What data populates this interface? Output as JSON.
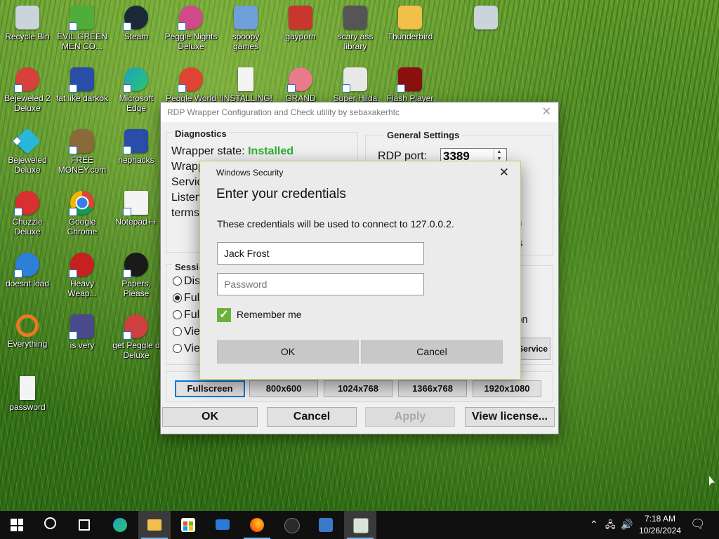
{
  "desktop_icons": [
    {
      "label": "Recycle Bin",
      "icon": "recycle-bin-icon",
      "color": "#c9d4dd"
    },
    {
      "label": "EVIL GREEN MEN CO...",
      "icon": "green-men-icon",
      "color": "#4fae3a"
    },
    {
      "label": "Steam",
      "icon": "steam-icon",
      "color": "#1b2838"
    },
    {
      "label": "Peggle Nights Deluxe",
      "icon": "peggle-nights-icon",
      "color": "#d04a8a"
    },
    {
      "label": "spoopy games",
      "icon": "folder-computers-icon",
      "color": "#6fa0d8"
    },
    {
      "label": "gayporn",
      "icon": "flash-folder-icon",
      "color": "#c8372d"
    },
    {
      "label": "scary ass library",
      "icon": "library-icon",
      "color": "#555555"
    },
    {
      "label": "Thunderbird",
      "icon": "folder-windows-icon",
      "color": "#f2c04a"
    },
    {
      "label": "",
      "icon": "recycle-bin-icon",
      "color": "#c9d4dd"
    },
    {
      "label": "Bejeweled 2 Deluxe",
      "icon": "bejeweled2-icon",
      "color": "#d8403c"
    },
    {
      "label": "fat like darkok",
      "icon": "mugen-icon",
      "color": "#2a4da8"
    },
    {
      "label": "Microsoft Edge",
      "icon": "edge-icon",
      "color": "#1aa3c8"
    },
    {
      "label": "Peggle World",
      "icon": "peggle-world-icon",
      "color": "#e04432"
    },
    {
      "label": "!INSTALLING!",
      "icon": "text-file-icon",
      "color": "#f4f4f4"
    },
    {
      "label": "GRAND",
      "icon": "anime-girl-icon",
      "color": "#e87a8a"
    },
    {
      "label": "Super Hilda",
      "icon": "hilda-icon",
      "color": "#e8e8e8"
    },
    {
      "label": "Flash Player",
      "icon": "flash-player-icon",
      "color": "#8a1010"
    },
    {
      "label": "Bejeweled Deluxe",
      "icon": "bejeweled-icon",
      "color": "#28b7d8"
    },
    {
      "label": "FREE MONEY.com",
      "icon": "money-bag-icon",
      "color": "#8a6a3a"
    },
    {
      "label": "nephacks",
      "icon": "mugen2-icon",
      "color": "#2a4da8"
    },
    {
      "label": "Chuzzle Deluxe",
      "icon": "chuzzle-icon",
      "color": "#d83030"
    },
    {
      "label": "Google Chrome",
      "icon": "chrome-icon",
      "color": "#e8c020"
    },
    {
      "label": "Notepad++",
      "icon": "notepadpp-icon",
      "color": "#f4f4f4"
    },
    {
      "label": "doesnt load",
      "icon": "globe-icon",
      "color": "#2e7fd8"
    },
    {
      "label": "Heavy Weap...",
      "icon": "heavy-weapon-icon",
      "color": "#c82020"
    },
    {
      "label": "Papers, Please",
      "icon": "papers-please-icon",
      "color": "#1a1a1a"
    },
    {
      "label": "Everything",
      "icon": "everything-icon",
      "color": "#e87a20"
    },
    {
      "label": "is very",
      "icon": "mugen3-icon",
      "color": "#4a4a8a"
    },
    {
      "label": "get Peggle d Deluxe",
      "icon": "peggle-deluxe-icon",
      "color": "#d04040"
    },
    {
      "label": "password",
      "icon": "text-file-icon",
      "color": "#f4f4f4"
    }
  ],
  "rdp_window": {
    "title": "RDP Wrapper Configuration and Check utility by sebaxakerhtc",
    "diagnostics_title": "Diagnostics",
    "wrapper_state_label": "Wrapper state:",
    "wrapper_state_value": "Installed",
    "partial_lines": [
      "Wrapp",
      "Servic",
      "Listen",
      "terms"
    ],
    "general_settings_title": "General Settings",
    "rdp_port_label": "RDP port:",
    "rdp_port_value": "3389",
    "right_partials": [
      "n",
      "s",
      "on"
    ],
    "service_btn_partial": "Service",
    "session_title_partial": "Sessio",
    "radio_options": [
      "Dis",
      "Full",
      "Ful",
      "Vie",
      "Vie"
    ],
    "resolutions": [
      "Fullscreen",
      "800x600",
      "1024x768",
      "1366x768",
      "1920x1080"
    ],
    "ok_label": "OK",
    "cancel_label": "Cancel",
    "apply_label": "Apply",
    "license_label": "View license..."
  },
  "credentials": {
    "window_title": "Windows Security",
    "heading": "Enter your credentials",
    "description": "These credentials will be used to connect to 127.0.0.2.",
    "username_value": "Jack Frost",
    "password_placeholder": "Password",
    "remember_label": "Remember me",
    "remember_checked": true,
    "ok_label": "OK",
    "cancel_label": "Cancel",
    "accent_color": "#6cb23a"
  },
  "taskbar": {
    "time": "7:18 AM",
    "date": "10/26/2024",
    "pinned": [
      {
        "icon": "windows-start-icon"
      },
      {
        "icon": "search-icon"
      },
      {
        "icon": "task-view-icon"
      },
      {
        "icon": "edge-icon"
      },
      {
        "icon": "file-explorer-icon"
      },
      {
        "icon": "store-icon"
      },
      {
        "icon": "mail-icon"
      },
      {
        "icon": "firefox-icon"
      },
      {
        "icon": "terminal-icon"
      },
      {
        "icon": "remote-desktop-icon"
      },
      {
        "icon": "rdp-config-icon"
      }
    ]
  }
}
